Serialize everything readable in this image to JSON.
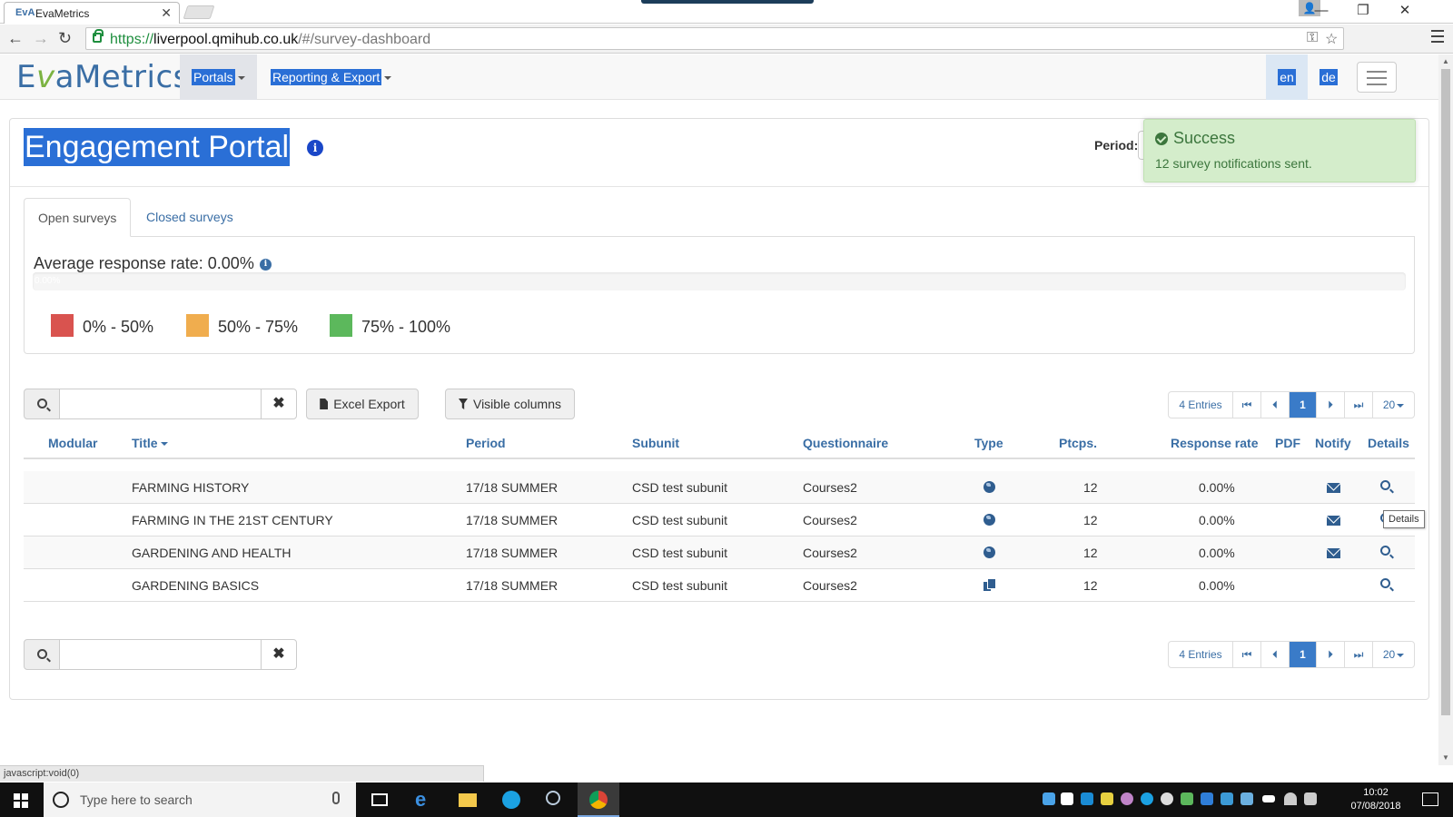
{
  "browser": {
    "tab_title": "EvaMetrics",
    "tab_favicon": "EvA",
    "url_scheme": "https://",
    "url_host": "liverpool.qmihub.co.uk",
    "url_path": "/#/survey-dashboard"
  },
  "navbar": {
    "logo": {
      "before": "E",
      "v": "v",
      "after": "aMetrics"
    },
    "portals_label": "Portals",
    "reporting_label": "Reporting & Export",
    "lang_en": "en",
    "lang_de": "de"
  },
  "header": {
    "title": "Engagement Portal",
    "period_label": "Period:"
  },
  "toast": {
    "title": "Success",
    "message": "12 survey notifications sent."
  },
  "tabs": [
    {
      "label": "Open surveys"
    },
    {
      "label": "Closed surveys"
    }
  ],
  "response_rate": {
    "title": "Average response rate: 0.00%",
    "progress_text": "0.00%",
    "progress_fraction": 0.0,
    "legend": [
      {
        "label": "0% - 50%",
        "color": "#d9534f"
      },
      {
        "label": "50% - 75%",
        "color": "#f0ad4e"
      },
      {
        "label": "75% - 100%",
        "color": "#5cb85c"
      }
    ]
  },
  "toolbar": {
    "search_value": "",
    "clear_label": "✖",
    "excel_label": "Excel Export",
    "columns_label": "Visible columns"
  },
  "pager": {
    "entries_label": "4 Entries",
    "current_page": "1",
    "page_size": "20",
    "first": "⏮",
    "prev": "⏴",
    "next": "⏵",
    "last": "⏭"
  },
  "table": {
    "columns": [
      "Modular",
      "Title",
      "Period",
      "Subunit",
      "Questionnaire",
      "Type",
      "Ptcps.",
      "Response rate",
      "PDF",
      "Notify",
      "Details"
    ],
    "rows": [
      {
        "title": "FARMING HISTORY",
        "period": "17/18 SUMMER",
        "subunit": "CSD test subunit",
        "questionnaire": "Courses2",
        "type_icon": "globe-icon",
        "ptcps": "12",
        "rate": "0.00%",
        "notify": true
      },
      {
        "title": "FARMING IN THE 21ST CENTURY",
        "period": "17/18 SUMMER",
        "subunit": "CSD test subunit",
        "questionnaire": "Courses2",
        "type_icon": "globe-icon",
        "ptcps": "12",
        "rate": "0.00%",
        "notify": true
      },
      {
        "title": "GARDENING AND HEALTH",
        "period": "17/18 SUMMER",
        "subunit": "CSD test subunit",
        "questionnaire": "Courses2",
        "type_icon": "globe-icon",
        "ptcps": "12",
        "rate": "0.00%",
        "notify": true
      },
      {
        "title": "GARDENING BASICS",
        "period": "17/18 SUMMER",
        "subunit": "CSD test subunit",
        "questionnaire": "Courses2",
        "type_icon": "copy-icon",
        "ptcps": "12",
        "rate": "0.00%",
        "notify": false
      }
    ]
  },
  "tooltip": "Details",
  "statusbar": "javascript:void(0)",
  "taskbar": {
    "search_placeholder": "Type here to search",
    "time": "10:02",
    "date": "07/08/2018"
  },
  "colors": {
    "primary": "#3a6ea5",
    "selection": "#2a6fd6",
    "success_bg": "#d4edcb",
    "success_text": "#3c763d"
  }
}
